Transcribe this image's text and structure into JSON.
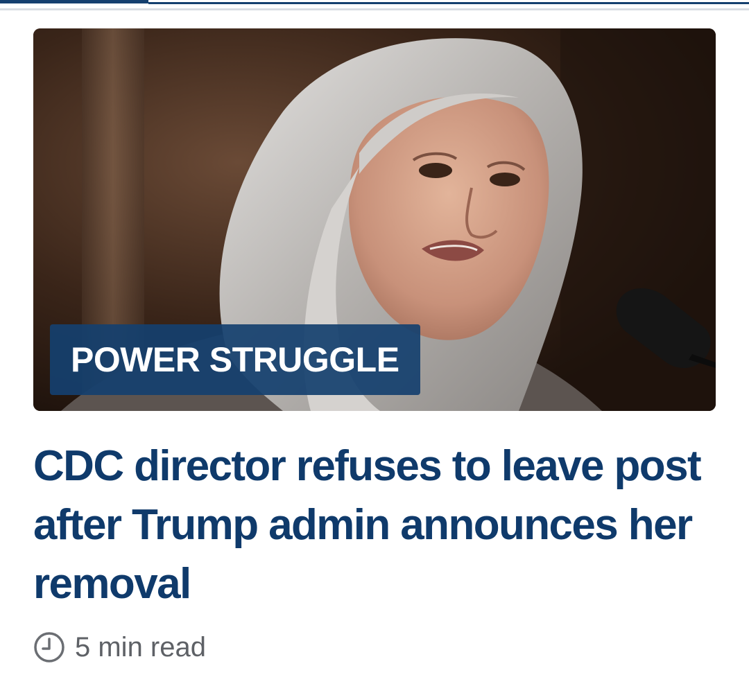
{
  "colors": {
    "brand_navy": "#15406f",
    "headline": "#0f3a6b",
    "meta_text": "#5e6166"
  },
  "hero": {
    "image_description": "Photo of a woman with long gray hair speaking at a microphone",
    "kicker": "POWER STRUGGLE"
  },
  "article": {
    "headline": "CDC director refuses to leave post after Trump admin announces her removal",
    "read_time": "5 min read",
    "read_time_icon": "clock-icon"
  }
}
